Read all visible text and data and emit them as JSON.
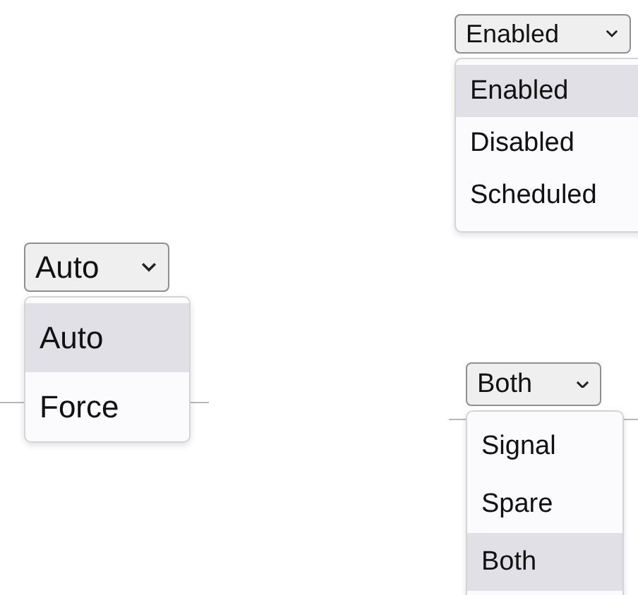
{
  "dropdowns": [
    {
      "value": "Enabled",
      "options": [
        {
          "label": "Enabled",
          "selected": true
        },
        {
          "label": "Disabled",
          "selected": false
        },
        {
          "label": "Scheduled",
          "selected": false
        }
      ]
    },
    {
      "value": "Auto",
      "options": [
        {
          "label": "Auto",
          "selected": true
        },
        {
          "label": "Force",
          "selected": false
        }
      ]
    },
    {
      "value": "Both",
      "options": [
        {
          "label": "Signal",
          "selected": false
        },
        {
          "label": "Spare",
          "selected": false
        },
        {
          "label": "Both",
          "selected": true
        }
      ]
    }
  ]
}
